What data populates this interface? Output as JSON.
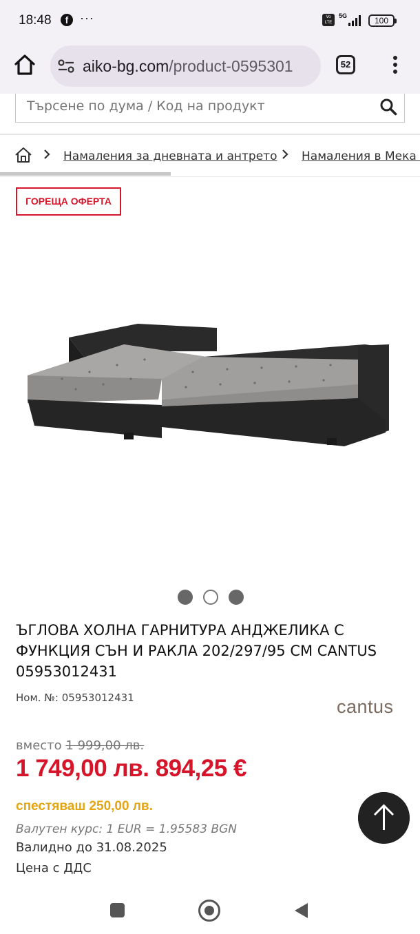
{
  "status": {
    "time": "18:48",
    "fb": "f",
    "more": "···",
    "volte": "Vo LTE",
    "network": "5G",
    "battery": "100"
  },
  "browser": {
    "url_host": "aiko-bg.com",
    "url_path": "/product-0595301",
    "tabs_count": "52"
  },
  "search": {
    "placeholder": "Търсене по дума / Код на продукт"
  },
  "breadcrumb": {
    "items": [
      {
        "label": "Намаления за дневната и антрето"
      },
      {
        "label": "Намаления в Мека мебел"
      }
    ]
  },
  "badge": {
    "label": "ГОРЕЩА ОФЕРТА"
  },
  "carousel": {
    "count": 3,
    "active_index": 1
  },
  "product": {
    "title_line1": "ЪГЛОВА ХОЛНА ГАРНИТУРА АНДЖЕЛИКА С",
    "title_line2": "ФУНКЦИЯ СЪН И РАКЛА 202/297/95 СМ CANTUS",
    "title_line3": "05953012431",
    "sku_label": "Ном. №:",
    "sku": "05953012431",
    "brand": "cantus"
  },
  "pricing": {
    "old_label": "вместо",
    "old_price": "1 999,00 лв.",
    "price_bgn": "1 749,00 лв.",
    "price_eur": "894,25 €",
    "savings": "спестяваш 250,00 лв.",
    "rate": "Валутен курс: 1 EUR = 1.95583 BGN",
    "valid": "Валидно до 31.08.2025",
    "vat": "Цена с ДДС"
  },
  "colors": {
    "accent": "#d7152a",
    "savings": "#e3a512",
    "dark": "#222222"
  }
}
